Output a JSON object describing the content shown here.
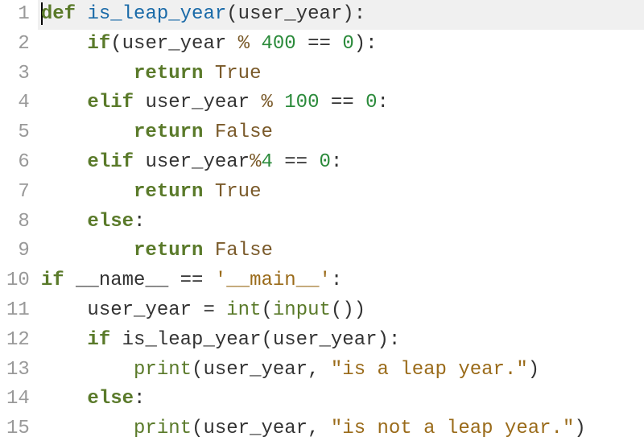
{
  "lines": [
    {
      "no": "1"
    },
    {
      "no": "2"
    },
    {
      "no": "3"
    },
    {
      "no": "4"
    },
    {
      "no": "5"
    },
    {
      "no": "6"
    },
    {
      "no": "7"
    },
    {
      "no": "8"
    },
    {
      "no": "9"
    },
    {
      "no": "10"
    },
    {
      "no": "11"
    },
    {
      "no": "12"
    },
    {
      "no": "13"
    },
    {
      "no": "14"
    },
    {
      "no": "15"
    }
  ],
  "tokens": {
    "def": "def",
    "is_leap_year": "is_leap_year",
    "user_year": "user_year",
    "if": "if",
    "elif": "elif",
    "else": "else",
    "return": "return",
    "true": "True",
    "false": "False",
    "name": "__name__",
    "main": "'__main__'",
    "int": "int",
    "input": "input",
    "print": "print",
    "n400": "400",
    "n100": "100",
    "n4": "4",
    "n0": "0",
    "eq": "==",
    "pct": "%",
    "colon": ":",
    "lparen": "(",
    "rparen": ")",
    "comma": ",",
    "assign": "=",
    "str_leap": "\"is a leap year.\"",
    "str_notleap": "\"is not a leap year.\""
  }
}
